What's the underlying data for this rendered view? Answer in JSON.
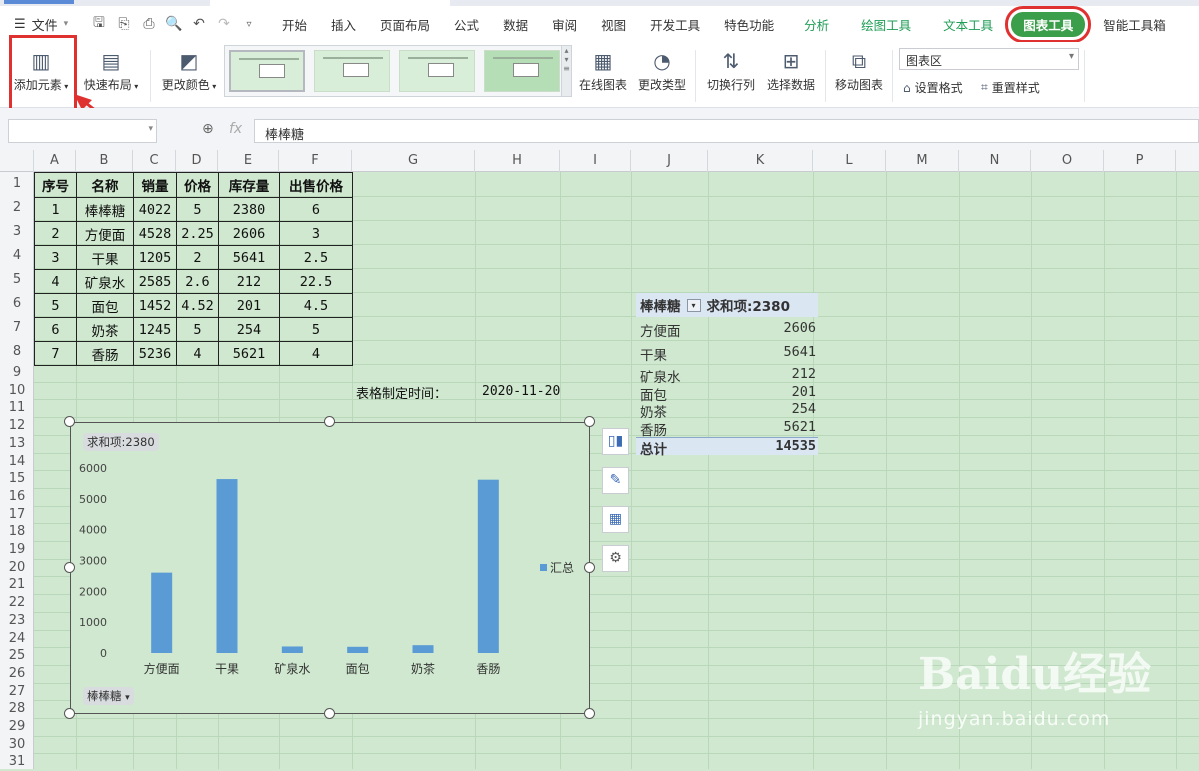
{
  "menu": {
    "file_label": "文件",
    "tabs": [
      "开始",
      "插入",
      "页面布局",
      "公式",
      "数据",
      "审阅",
      "视图",
      "开发工具",
      "特色功能",
      "分析",
      "绘图工具",
      "文本工具",
      "图表工具",
      "智能工具箱"
    ],
    "active_tab": "图表工具"
  },
  "ribbon": {
    "add_element": "添加元素",
    "quick_layout": "快速布局",
    "change_color": "更改颜色",
    "online_chart": "在线图表",
    "change_type": "更改类型",
    "switch_rowcol": "切换行列",
    "select_data": "选择数据",
    "move_chart": "移动图表",
    "chart_area_select": "图表区",
    "set_format": "设置格式",
    "reset_style": "重置样式"
  },
  "formula": {
    "fx": "fx",
    "content": "棒棒糖"
  },
  "columns": [
    "A",
    "B",
    "C",
    "D",
    "E",
    "F",
    "G",
    "H",
    "I",
    "J",
    "K",
    "L",
    "M",
    "N",
    "O",
    "P"
  ],
  "rows": [
    "1",
    "2",
    "3",
    "4",
    "5",
    "6",
    "7",
    "8",
    "9",
    "10",
    "11",
    "12",
    "13",
    "14",
    "15",
    "16",
    "17",
    "18",
    "19",
    "20",
    "21",
    "22",
    "23",
    "24",
    "25",
    "26",
    "27",
    "28",
    "29",
    "30",
    "31"
  ],
  "table": {
    "headers": [
      "序号",
      "名称",
      "销量",
      "价格",
      "库存量",
      "出售价格"
    ],
    "rows": [
      [
        "1",
        "棒棒糖",
        "4022",
        "5",
        "2380",
        "6"
      ],
      [
        "2",
        "方便面",
        "4528",
        "2.25",
        "2606",
        "3"
      ],
      [
        "3",
        "干果",
        "1205",
        "2",
        "5641",
        "2.5"
      ],
      [
        "4",
        "矿泉水",
        "2585",
        "2.6",
        "212",
        "22.5"
      ],
      [
        "5",
        "面包",
        "1452",
        "4.52",
        "201",
        "4.5"
      ],
      [
        "6",
        "奶茶",
        "1245",
        "5",
        "254",
        "5"
      ],
      [
        "7",
        "香肠",
        "5236",
        "4",
        "5621",
        "4"
      ]
    ]
  },
  "made_time_label": "表格制定时间：",
  "made_time_value": "2020-11-20",
  "pivot": {
    "header_field": "棒棒糖",
    "header_value": "求和项:2380",
    "rows": [
      {
        "name": "方便面",
        "value": "2606"
      },
      {
        "name": "干果",
        "value": "5641"
      },
      {
        "name": "矿泉水",
        "value": "212"
      },
      {
        "name": "面包",
        "value": "201"
      },
      {
        "name": "奶茶",
        "value": "254"
      },
      {
        "name": "香肠",
        "value": "5621"
      }
    ],
    "total_label": "总计",
    "total_value": "14535"
  },
  "chart_data": {
    "type": "bar",
    "title": "求和项:2380",
    "categories": [
      "方便面",
      "干果",
      "矿泉水",
      "面包",
      "奶茶",
      "香肠"
    ],
    "series": [
      {
        "name": "汇总",
        "values": [
          2606,
          5641,
          212,
          201,
          254,
          5621
        ],
        "color": "#5b9bd5"
      }
    ],
    "ylim": [
      0,
      6000
    ],
    "yticks": [
      0,
      1000,
      2000,
      3000,
      4000,
      5000,
      6000
    ],
    "legend_position": "right",
    "filter_button": "棒棒糖"
  },
  "watermark": {
    "brand": "Baidu经验",
    "url": "jingyan.baidu.com"
  },
  "colors": {
    "active_tab": "#3a9e4a",
    "highlight": "#e03131",
    "sheet_bg": "#cfe8cf",
    "bar": "#5b9bd5"
  }
}
